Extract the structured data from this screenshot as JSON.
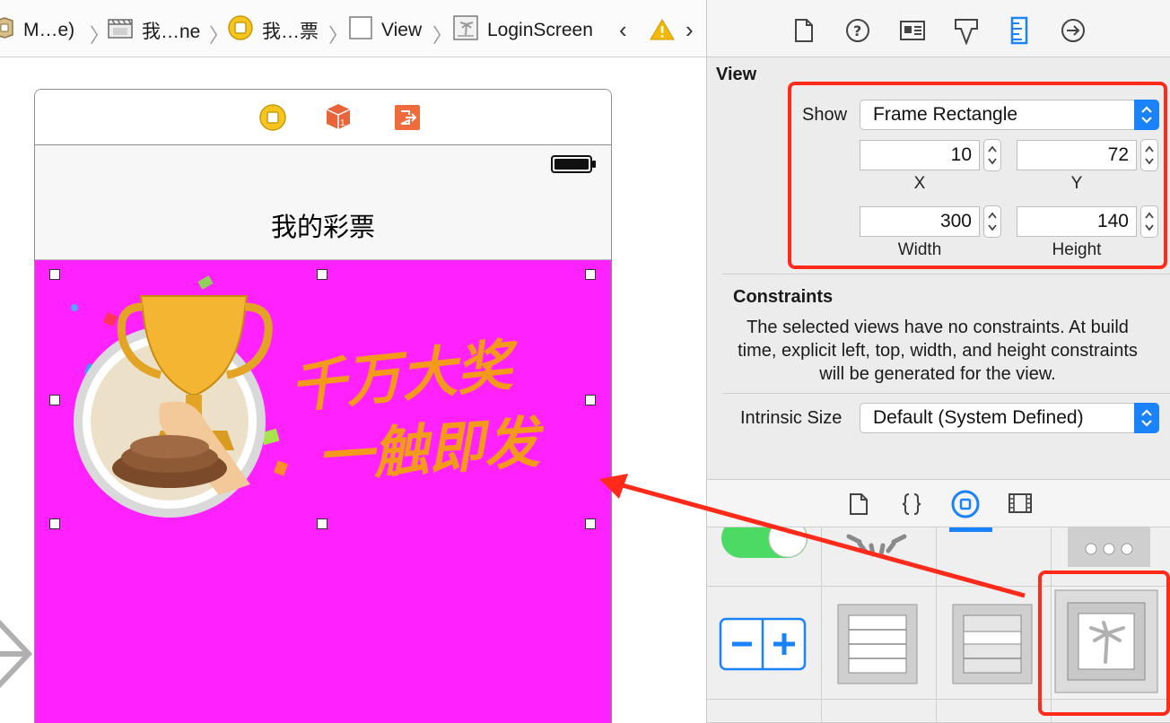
{
  "jump_bar": {
    "crumbs": [
      "M…e)",
      "我…ne",
      "我…票",
      "View",
      "LoginScreen"
    ]
  },
  "scene": {
    "nav_title": "我的彩票",
    "banner": {
      "line1": "千万大奖",
      "line2": "一触即发",
      "text_color": "#f39a1c"
    },
    "view_color": "#ff22ff"
  },
  "inspector": {
    "section_title": "View",
    "show_label": "Show",
    "show_value": "Frame Rectangle",
    "frame": {
      "x": "10",
      "y": "72",
      "width": "300",
      "height": "140",
      "x_label": "X",
      "y_label": "Y",
      "width_label": "Width",
      "height_label": "Height"
    },
    "constraints_title": "Constraints",
    "constraints_text": "The selected views have no constraints. At build time, explicit left, top, width, and height constraints will be generated for the view.",
    "intrinsic_label": "Intrinsic Size",
    "intrinsic_value": "Default (System Defined)"
  },
  "colors": {
    "accent": "#1a82fb",
    "highlight": "#ff2a1a",
    "pink_view": "#ff22ff"
  },
  "icons": {
    "inspector_tabs": [
      "file-inspector-icon",
      "quick-help-icon",
      "identity-inspector-icon",
      "attributes-inspector-icon",
      "size-inspector-icon",
      "connections-inspector-icon"
    ],
    "library_tabs": [
      "file-template-icon",
      "code-snippet-icon",
      "object-library-icon",
      "media-library-icon"
    ],
    "library_items": [
      "switch-icon",
      "activity-indicator-icon",
      "progress-view-icon",
      "page-control-icon",
      "stepper-icon",
      "table-view-icon",
      "table-view-cell-icon",
      "image-view-icon"
    ]
  }
}
